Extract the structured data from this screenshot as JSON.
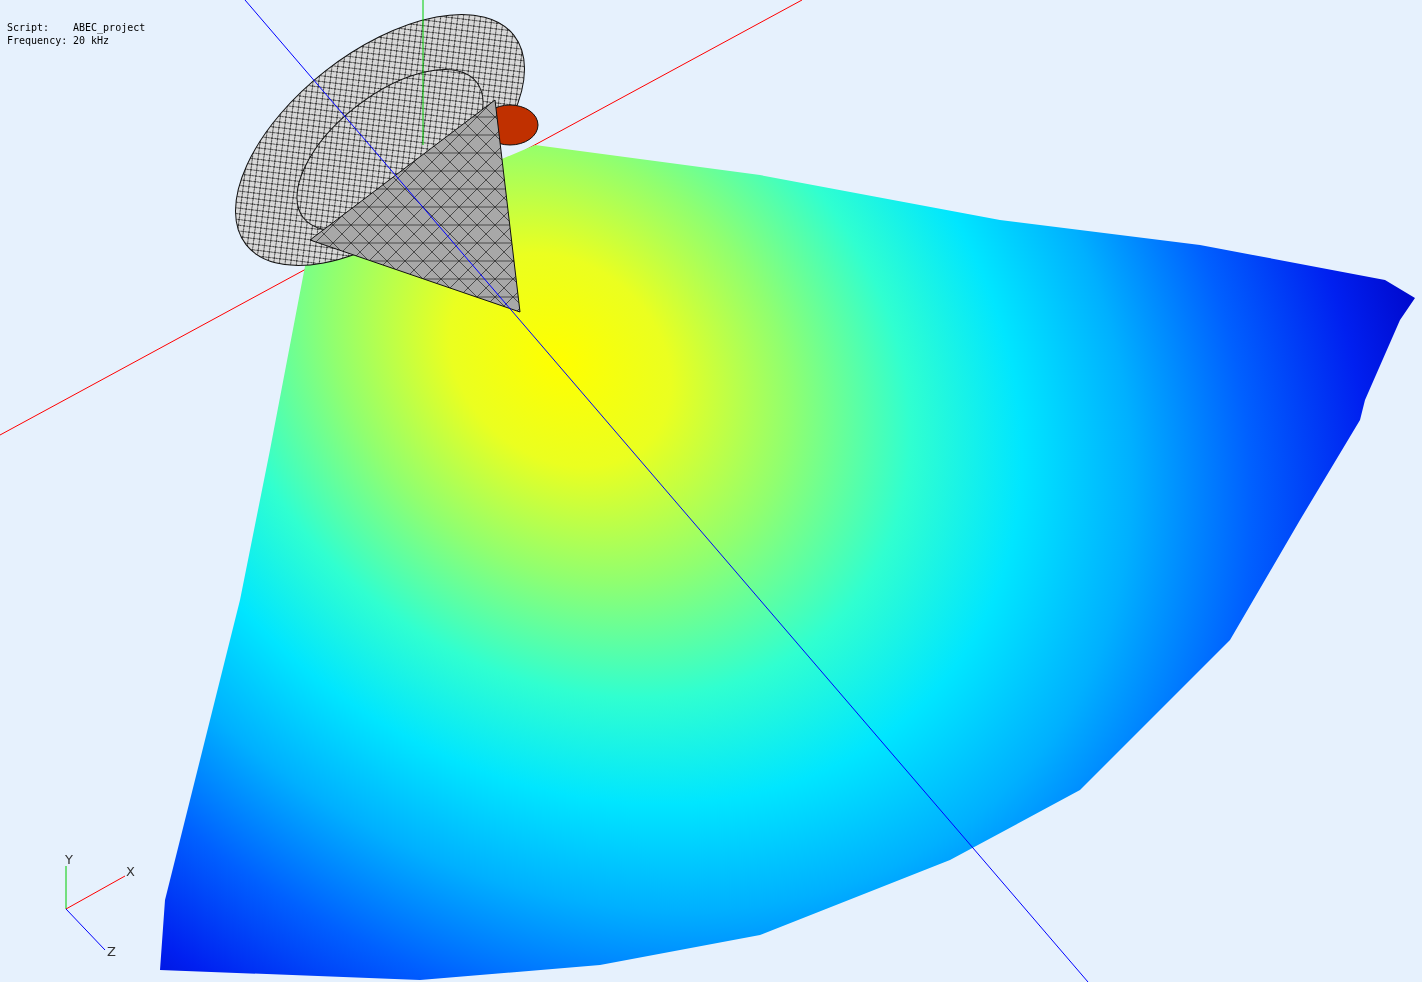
{
  "info": [
    {
      "label": "Script:",
      "value": "ABEC_project"
    },
    {
      "label": "Frequency:",
      "value": "20 kHz"
    }
  ],
  "triad": {
    "axes": [
      {
        "kind": "y",
        "label": "Y"
      },
      {
        "kind": "x",
        "label": "X"
      },
      {
        "kind": "z",
        "label": "Z"
      }
    ]
  }
}
